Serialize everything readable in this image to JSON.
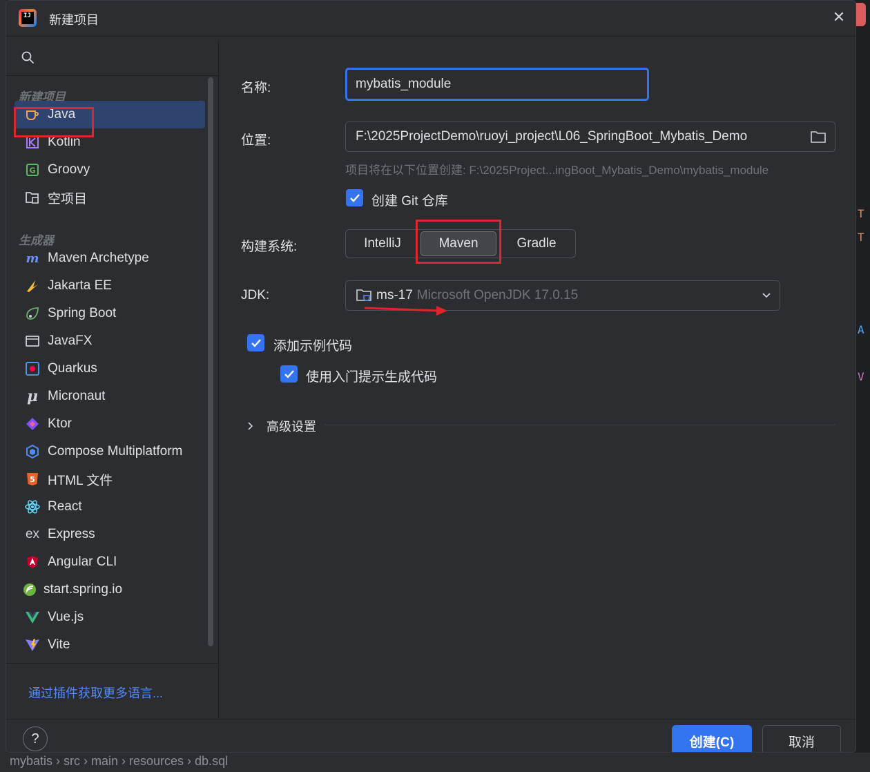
{
  "window": {
    "title": "新建项目",
    "close_glyph": "✕"
  },
  "sidebar": {
    "sections": [
      {
        "label": "新建项目",
        "items": [
          {
            "label": "Java",
            "icon": "java-cup-icon",
            "selected": true
          },
          {
            "label": "Kotlin",
            "icon": "kotlin-icon"
          },
          {
            "label": "Groovy",
            "icon": "groovy-icon"
          },
          {
            "label": "空项目",
            "icon": "empty-project-icon"
          }
        ]
      },
      {
        "label": "生成器",
        "items": [
          {
            "label": "Maven Archetype",
            "icon": "maven-icon"
          },
          {
            "label": "Jakarta EE",
            "icon": "jakarta-icon"
          },
          {
            "label": "Spring Boot",
            "icon": "spring-boot-icon"
          },
          {
            "label": "JavaFX",
            "icon": "javafx-icon"
          },
          {
            "label": "Quarkus",
            "icon": "quarkus-icon"
          },
          {
            "label": "Micronaut",
            "icon": "micronaut-icon"
          },
          {
            "label": "Ktor",
            "icon": "ktor-icon"
          },
          {
            "label": "Compose Multiplatform",
            "icon": "compose-icon"
          },
          {
            "label": "HTML 文件",
            "icon": "html5-icon"
          },
          {
            "label": "React",
            "icon": "react-icon"
          },
          {
            "label": "Express",
            "icon": "express-icon"
          },
          {
            "label": "Angular CLI",
            "icon": "angular-icon"
          },
          {
            "label": "start.spring.io",
            "icon": "spring-icon"
          },
          {
            "label": "Vue.js",
            "icon": "vue-icon"
          },
          {
            "label": "Vite",
            "icon": "vite-icon"
          }
        ]
      }
    ],
    "plugins_link": "通过插件获取更多语言..."
  },
  "form": {
    "name_label": "名称:",
    "name_value": "mybatis_module",
    "location_label": "位置:",
    "location_value": "F:\\2025ProjectDemo\\ruoyi_project\\L06_SpringBoot_Mybatis_Demo",
    "location_hint": "项目将在以下位置创建: F:\\2025Project...ingBoot_Mybatis_Demo\\mybatis_module",
    "git_label": "创建 Git 仓库",
    "build_label": "构建系统:",
    "build_options": [
      "IntelliJ",
      "Maven",
      "Gradle"
    ],
    "build_selected": "Maven",
    "jdk_label": "JDK:",
    "jdk_name": "ms-17",
    "jdk_desc": "Microsoft OpenJDK 17.0.15",
    "sample_code_label": "添加示例代码",
    "onboarding_label": "使用入门提示生成代码",
    "advanced_label": "高级设置"
  },
  "footer": {
    "help": "?",
    "create": "创建(C)",
    "cancel": "取消"
  },
  "background": {
    "breadcrumb": "mybatis  ›  src  ›  main  ›  resources  ›  db.sql"
  },
  "colors": {
    "accent": "#3574f0",
    "annotation": "#e0262d",
    "dialog_bg": "#2b2d30",
    "selected_bg": "#2e436e"
  }
}
